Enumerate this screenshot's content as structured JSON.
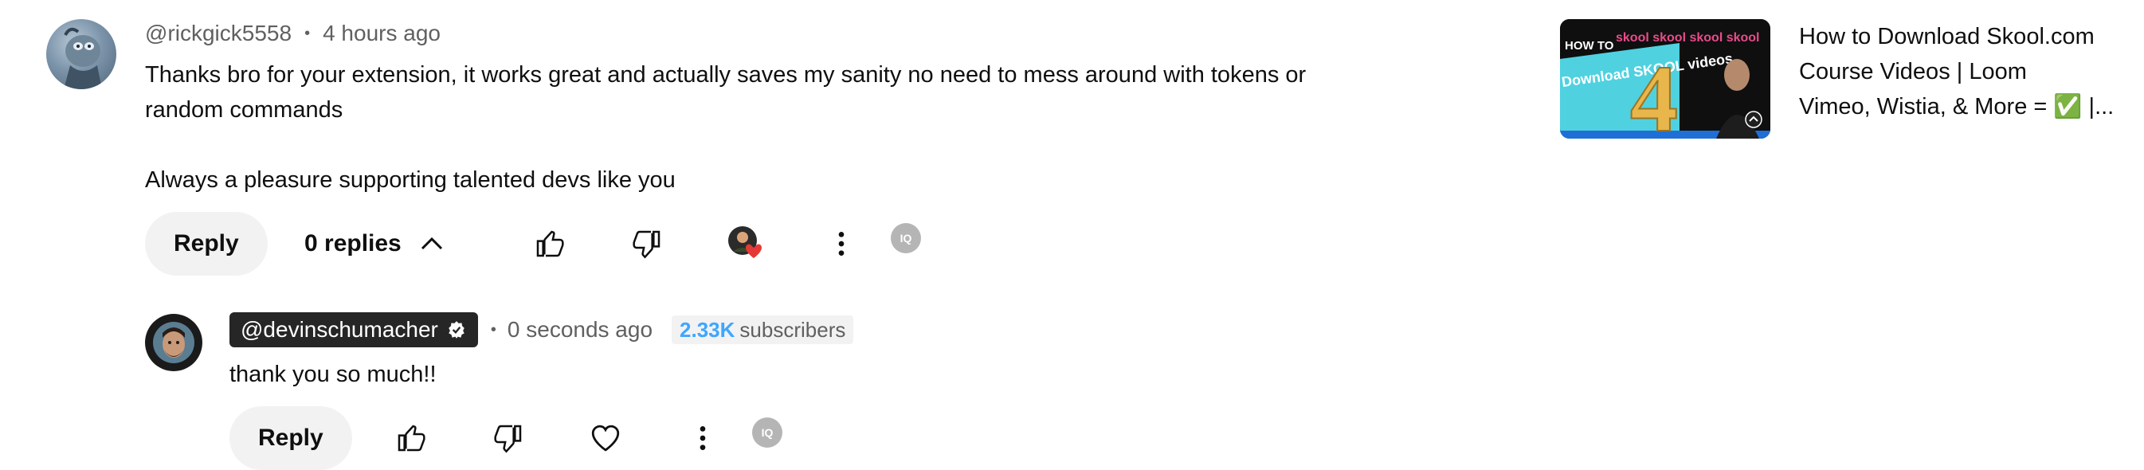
{
  "comment": {
    "author": "@rickgick5558",
    "time": "4 hours ago",
    "text_line1": "Thanks bro for your extension, it works great and actually saves my sanity no need to mess around with tokens or",
    "text_line2": "random commands",
    "text_line3": "Always a pleasure supporting talented devs like you",
    "reply_label": "Reply",
    "replies_label": "0 replies",
    "iq_label": "IQ"
  },
  "reply": {
    "author": "@devinschumacher",
    "time": "0 seconds ago",
    "subscriber_count": "2.33K",
    "subscriber_label": "subscribers",
    "text": "thank you so much!!",
    "reply_label": "Reply",
    "iq_label": "IQ"
  },
  "related_video": {
    "title_line1": "How to Download Skool.com",
    "title_line2": "Course Videos | Loom",
    "title_line3": "Vimeo, Wistia, & More = ✅ |...",
    "thumb_text_top": "HOW TO",
    "thumb_text_main": "Download SKOOL videos",
    "thumb_number": "4",
    "thumb_brand": "skool skool skool skool"
  },
  "colors": {
    "accent_blue": "#3ea6ff",
    "chip_dark": "#262626",
    "button_bg": "#f2f2f2",
    "heart_red": "#e53935",
    "thumb_cyan": "#4fd1e0"
  }
}
